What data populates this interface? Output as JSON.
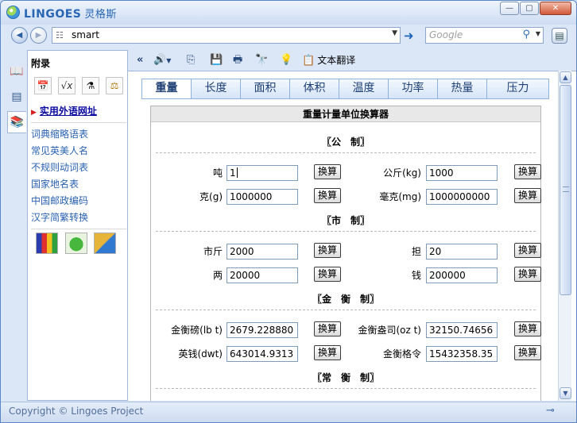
{
  "app": {
    "brand": "LINGOES",
    "brand_cn": "灵格斯"
  },
  "address": {
    "value": "smart"
  },
  "search": {
    "placeholder": "Google"
  },
  "window_buttons": {
    "minimize": "—",
    "maximize": "▢",
    "close": "✕"
  },
  "nav": {
    "back": "◀",
    "forward": "▶",
    "go": "➜",
    "menu": "▤"
  },
  "sidebar": {
    "heading": "附录",
    "icons": [
      "calendar-icon",
      "sqrt-icon",
      "flask-icon",
      "scale-icon"
    ],
    "links": [
      {
        "label": "实用外语网址",
        "current": true
      },
      {
        "label": "词典缩略语表"
      },
      {
        "label": "常见英美人名"
      },
      {
        "label": "不规则动词表"
      },
      {
        "label": "国家地名表"
      },
      {
        "label": "中国邮政编码"
      },
      {
        "label": "汉字简繁转换"
      }
    ],
    "games": [
      "tetris-icon",
      "dragon-icon",
      "puzzle-icon"
    ]
  },
  "toolbar": {
    "translate_label": "文本翻译"
  },
  "tabs": [
    "重量",
    "长度",
    "面积",
    "体积",
    "温度",
    "功率",
    "热量",
    "压力"
  ],
  "active_tab": 0,
  "calculator": {
    "title": "重量计量单位换算器",
    "button_label": "换算",
    "sections": [
      {
        "heading": "〖公　制〗",
        "rows": [
          [
            {
              "label": "吨",
              "value": "1"
            },
            {
              "label": "公斤(kg)",
              "value": "1000"
            }
          ],
          [
            {
              "label": "克(g)",
              "value": "1000000"
            },
            {
              "label": "毫克(mg)",
              "value": "1000000000"
            }
          ]
        ]
      },
      {
        "heading": "〖市　制〗",
        "rows": [
          [
            {
              "label": "市斤",
              "value": "2000"
            },
            {
              "label": "担",
              "value": "20"
            }
          ],
          [
            {
              "label": "两",
              "value": "20000"
            },
            {
              "label": "钱",
              "value": "200000"
            }
          ]
        ]
      },
      {
        "heading": "〖金　衡　制〗",
        "rows": [
          [
            {
              "label": "金衡磅(lb t)",
              "value": "2679.228880"
            },
            {
              "label": "金衡盎司(oz t)",
              "value": "32150.74656"
            }
          ],
          [
            {
              "label": "英钱(dwt)",
              "value": "643014.9313"
            },
            {
              "label": "金衡格令",
              "value": "15432358.35"
            }
          ]
        ]
      },
      {
        "heading": "〖常　衡　制〗",
        "rows": []
      }
    ]
  },
  "status": {
    "copyright": "Copyright © Lingoes Project"
  }
}
